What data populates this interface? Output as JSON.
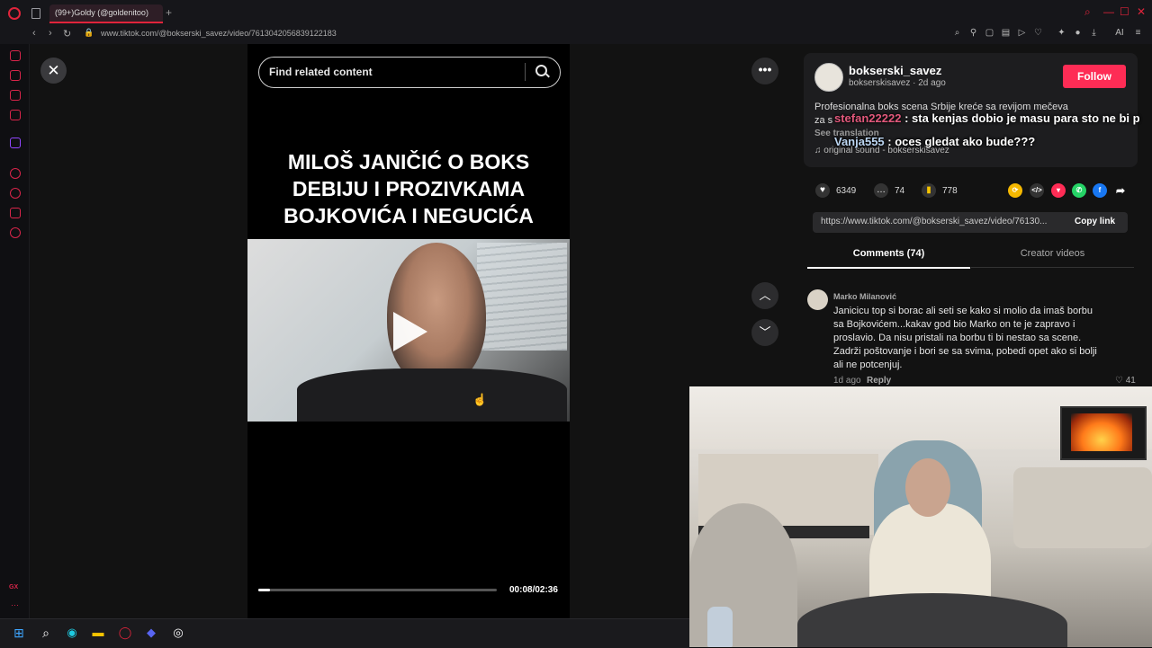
{
  "browser": {
    "tab_title": "(99+)Goldy (@goldenitoo)",
    "url": "www.tiktok.com/@bokserski_savez/video/7613042056839122183",
    "toolbar_ai_label": "AI"
  },
  "player": {
    "search_placeholder": "Find related content",
    "headline": "MILOŠ JANIČIĆ O BOKS DEBIJU I PROZIVKAMA BOJKOVIĆA I NEGUCIĆA",
    "progress_fraction": 0.05,
    "time": "00:08/02:36"
  },
  "post": {
    "username": "bokserski_savez",
    "handle": "bokserskisavez",
    "posted": "2d ago",
    "follow_label": "Follow",
    "description_line1": "Profesionalna boks scena Srbije kreće sa revijom mečeva",
    "description_line2": "za s",
    "see_translation": "See translation",
    "sound": "original sound - bokserskisavez",
    "likes": "6349",
    "comments": "74",
    "saves": "778",
    "link": "https://www.tiktok.com/@bokserski_savez/video/76130...",
    "copy_link": "Copy link"
  },
  "tabs": {
    "comments": "Comments (74)",
    "creator_videos": "Creator videos"
  },
  "comment": {
    "user": "Marko Milanović",
    "text": "Janicicu top si borac ali seti se kako si molio da imaš borbu sa Bojkovićem...kakav god bio Marko on te je zapravo i proslavio. Da nisu pristali na borbu ti bi nestao sa scene. Zadrži poštovanje i bori se sa svima, pobedi opet ako si bolji ali ne potcenjuj.",
    "age": "1d ago",
    "reply": "Reply",
    "likes": "41"
  },
  "chat_overlay": [
    {
      "name": "stefan22222",
      "message": " : sta kenjas dobio je masu para sto ne bi p"
    },
    {
      "name": "Vanja555",
      "message": " : oces gledat ako bude???"
    }
  ],
  "icons": {
    "close": "close-icon",
    "more": "more-icon",
    "play": "play-icon"
  },
  "colors": {
    "accent": "#fe2c55",
    "opera": "#e0243b"
  }
}
